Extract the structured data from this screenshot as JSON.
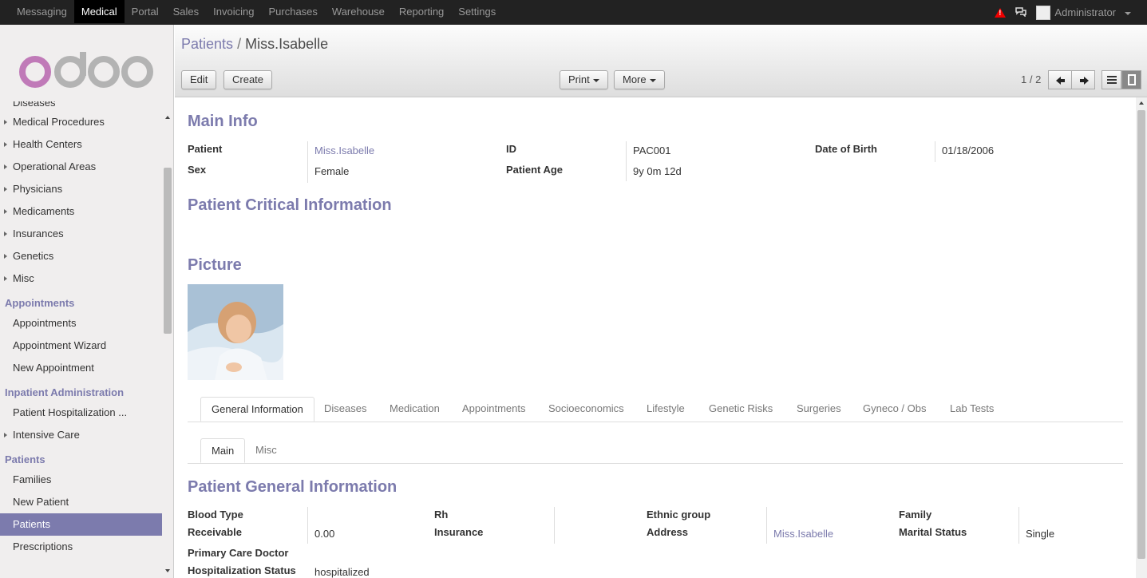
{
  "topbar": {
    "menu": [
      "Messaging",
      "Medical",
      "Portal",
      "Sales",
      "Invoicing",
      "Purchases",
      "Warehouse",
      "Reporting",
      "Settings"
    ],
    "active_menu": "Medical",
    "user": "Administrator",
    "alert_icon": "warning-icon",
    "chat_icon": "chat-icon",
    "alert_color": "#ee0000"
  },
  "sidebar": {
    "logo_text": "odoo",
    "cut_item": "Diseases",
    "groups": [
      {
        "items": [
          "Medical Procedures",
          "Health Centers",
          "Operational Areas",
          "Physicians",
          "Medicaments",
          "Insurances",
          "Genetics",
          "Misc"
        ]
      }
    ],
    "appointments": {
      "header": "Appointments",
      "items": [
        "Appointments",
        "Appointment Wizard",
        "New Appointment"
      ]
    },
    "inpatient": {
      "header": "Inpatient Administration",
      "items": [
        "Patient Hospitalization ...",
        "Intensive Care"
      ]
    },
    "patients": {
      "header": "Patients",
      "items": [
        "Families",
        "New Patient",
        "Patients",
        "Prescriptions"
      ],
      "selected": "Patients"
    },
    "accent_color": "#7c7bad"
  },
  "control_panel": {
    "breadcrumb_parent": "Patients",
    "breadcrumb_sep": "/",
    "breadcrumb_current": "Miss.Isabelle",
    "edit_label": "Edit",
    "create_label": "Create",
    "print_label": "Print",
    "more_label": "More",
    "pager": "1 / 2"
  },
  "form": {
    "main_info_title": "Main Info",
    "fields_row1": [
      {
        "label": "Patient",
        "value": "Miss.Isabelle"
      },
      {
        "label": "ID",
        "value": "PAC001"
      },
      {
        "label": "Date of Birth",
        "value": "01/18/2006"
      }
    ],
    "fields_row2": [
      {
        "label": "Sex",
        "value": "Female"
      },
      {
        "label": "Patient Age",
        "value": "9y 0m 12d"
      }
    ],
    "critical_title": "Patient Critical Information",
    "picture_title": "Picture",
    "tabs": [
      "General Information",
      "Diseases",
      "Medication",
      "Appointments",
      "Socioeconomics",
      "Lifestyle",
      "Genetic Risks",
      "Surgeries",
      "Gyneco / Obs",
      "Lab Tests"
    ],
    "active_tab": "General Information",
    "subtabs": [
      "Main",
      "Misc"
    ],
    "general_title": "Patient General Information",
    "general": {
      "blood_type_label": "Blood Type",
      "blood_type": "",
      "rh_label": "Rh",
      "rh": "",
      "ethnic_label": "Ethnic group",
      "ethnic": "",
      "family_label": "Family",
      "family": "",
      "receivable_label": "Receivable",
      "receivable": "0.00",
      "insurance_label": "Insurance",
      "insurance": "",
      "address_label": "Address",
      "address": "Miss.Isabelle",
      "marital_label": "Marital Status",
      "marital": "Single",
      "pcp_label": "Primary Care Doctor",
      "pcp": "",
      "hosp_label": "Hospitalization Status",
      "hosp": "hospitalized"
    }
  }
}
